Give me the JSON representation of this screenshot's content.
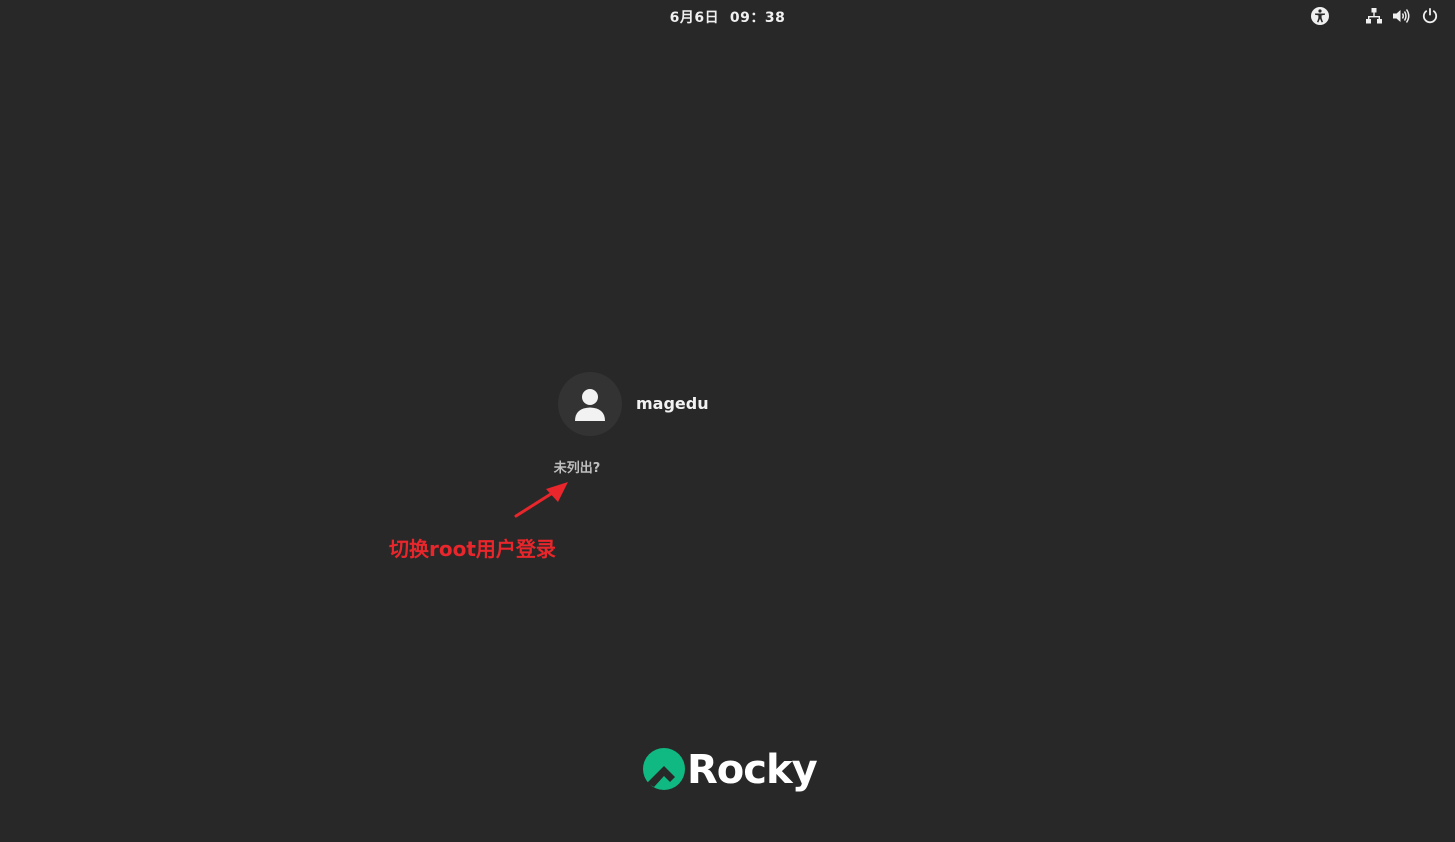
{
  "topbar": {
    "clock": "6月6日  09：38",
    "icons": {
      "accessibility": "accessibility-icon",
      "network": "network-wired-icon",
      "volume": "volume-icon",
      "power": "power-icon"
    }
  },
  "user_list": {
    "users": [
      {
        "name": "magedu",
        "avatar": "user-avatar-icon"
      }
    ],
    "not_listed_label": "未列出?"
  },
  "annotation": {
    "text": "切换root用户登录",
    "color": "#e8262b"
  },
  "branding": {
    "logo_text": "Rocky",
    "mark_color": "#10b981"
  }
}
